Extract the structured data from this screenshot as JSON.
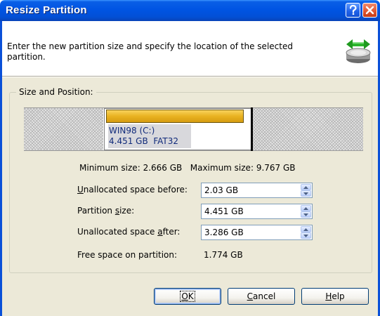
{
  "window": {
    "title": "Resize Partition",
    "help_glyph": "?",
    "close_glyph": "X"
  },
  "header": {
    "description": "Enter the new partition size and specify the location of the selected partition.",
    "icon": "drive-resize-icon"
  },
  "group": {
    "label": "Size and Position:"
  },
  "diskmap": {
    "partition_name": "WIN98 (C:)",
    "partition_info": "4.451 GB  FAT32"
  },
  "limits": {
    "min_label": "Minimum size:",
    "min_value": "2.666 GB",
    "max_label": "Maximum size:",
    "max_value": "9.767 GB"
  },
  "fields": {
    "before": {
      "label_pre": "",
      "label_key": "U",
      "label_post": "nallocated space before:",
      "value": "2.03 GB"
    },
    "size": {
      "label_pre": "Partition ",
      "label_key": "s",
      "label_post": "ize:",
      "value": "4.451 GB"
    },
    "after": {
      "label_pre": "Unallocated space ",
      "label_key": "a",
      "label_post": "fter:",
      "value": "3.286 GB"
    },
    "free": {
      "label": "Free space on partition:",
      "value": "1.774 GB"
    }
  },
  "buttons": {
    "ok": {
      "pre": "",
      "key": "O",
      "post": "K"
    },
    "cancel": {
      "pre": "",
      "key": "C",
      "post": "ancel"
    },
    "help": {
      "pre": "",
      "key": "H",
      "post": "elp"
    }
  },
  "colors": {
    "titlebar": "#0054e3",
    "dialog_bg": "#ece9d8",
    "partition_bar": "#e9b221",
    "partition_text": "#102a7a"
  }
}
